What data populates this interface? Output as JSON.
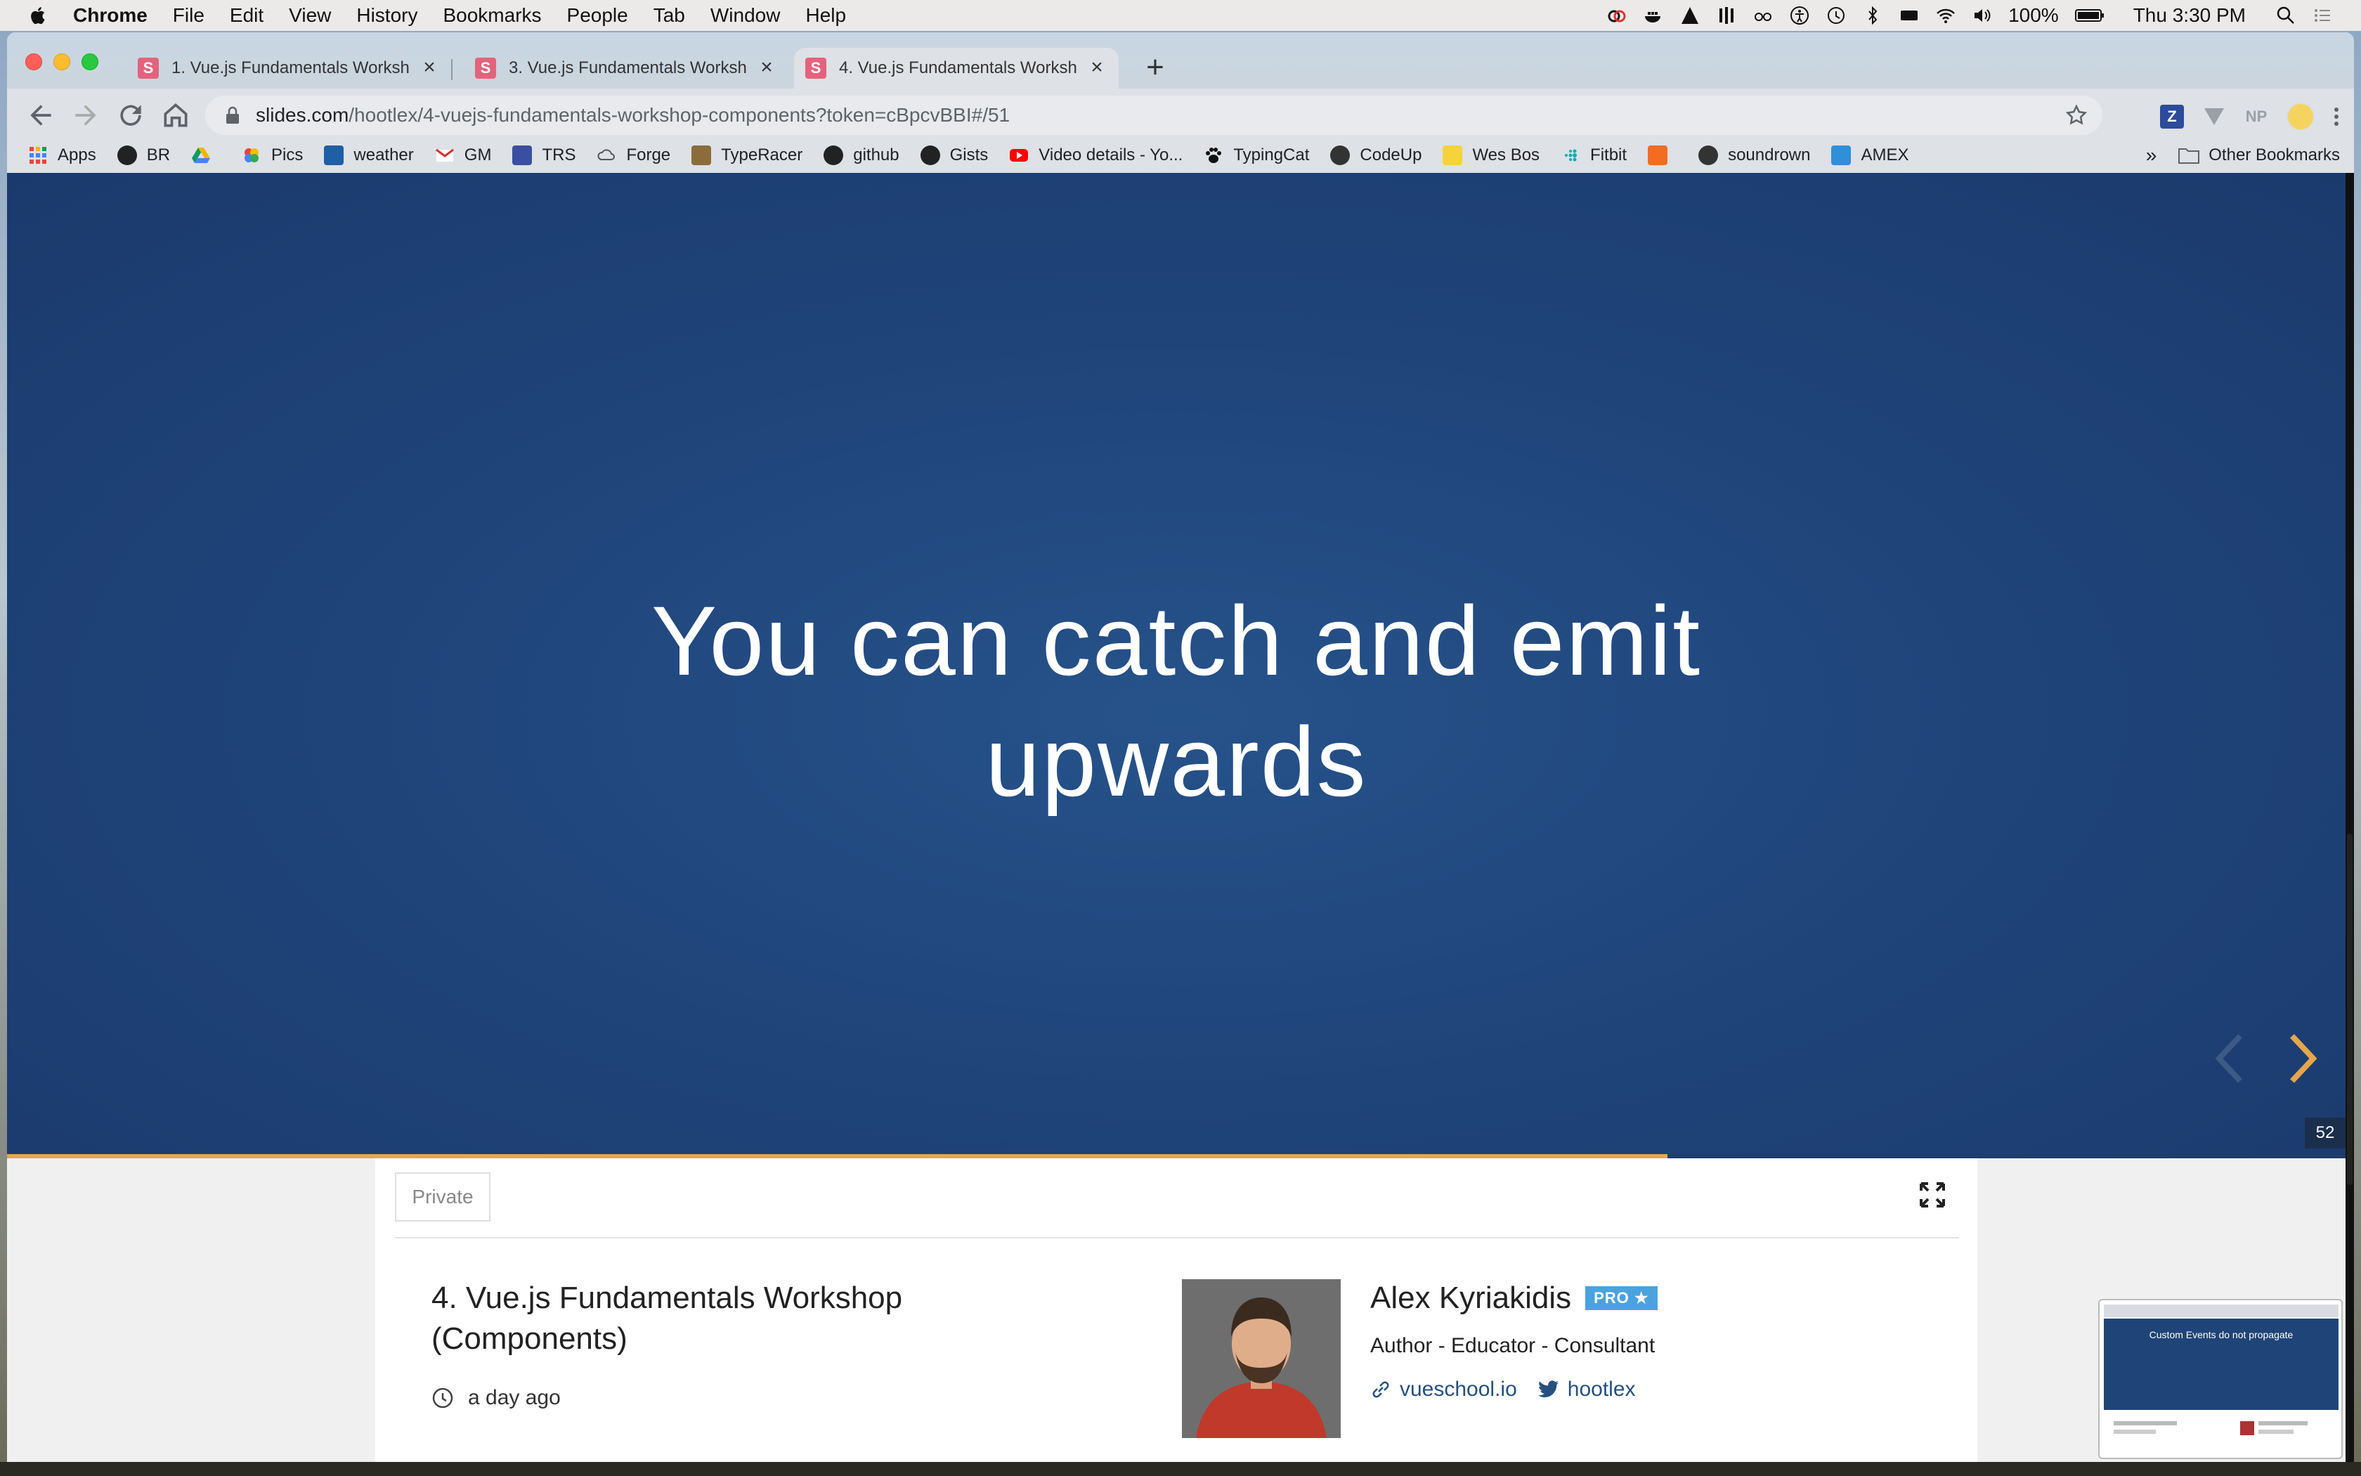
{
  "menubar": {
    "app": "Chrome",
    "items": [
      "File",
      "Edit",
      "View",
      "History",
      "Bookmarks",
      "People",
      "Tab",
      "Window",
      "Help"
    ],
    "battery": "100%",
    "clock": "Thu 3:30 PM"
  },
  "tabs": [
    {
      "title": "1. Vue.js Fundamentals Worksh",
      "favicon": "S"
    },
    {
      "title": "3. Vue.js Fundamentals Worksh",
      "favicon": "S"
    },
    {
      "title": "4. Vue.js Fundamentals Worksh",
      "favicon": "S"
    }
  ],
  "omnibox": {
    "host": "slides.com",
    "path": "/hootlex/4-vuejs-fundamentals-workshop-components?token=cBpcvBBI#/51"
  },
  "bookmarks": {
    "items": [
      "Apps",
      "BR",
      "",
      "Pics",
      "weather",
      "GM",
      "TRS",
      "Forge",
      "TypeRacer",
      "github",
      "Gists",
      "Video details - Yo...",
      "TypingCat",
      "CodeUp",
      "Wes Bos",
      "Fitbit",
      "",
      "soundrown",
      "AMEX"
    ],
    "more": "»",
    "other": "Other Bookmarks"
  },
  "slide": {
    "line1": "You can catch and emit",
    "line2": "upwards",
    "number": "52",
    "progress": 0.71
  },
  "card": {
    "private_label": "Private",
    "deck_title": "4. Vue.js Fundamentals Workshop (Components)",
    "time": "a day ago",
    "author_name": "Alex Kyriakidis",
    "pro_label": "PRO ★",
    "author_role": "Author - Educator - Consultant",
    "website": "vueschool.io",
    "twitter": "hootlex"
  },
  "pip": {
    "title": "Custom Events do not propagate"
  },
  "colors": {
    "slide_bg": "#1f447a",
    "progress": "#e6a64c",
    "next_arrow": "#e6a64c",
    "pro_badge": "#4aa3df",
    "link": "#25507f"
  }
}
